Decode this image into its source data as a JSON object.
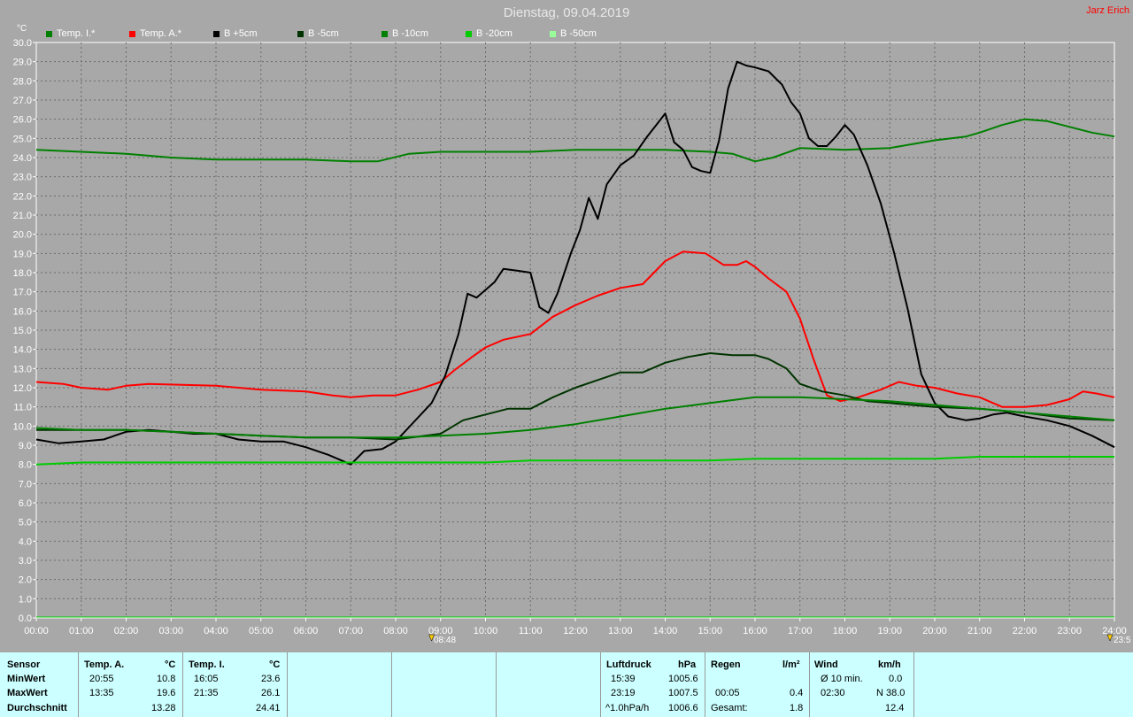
{
  "title": "Dienstag, 09.04.2019",
  "author": "Jarz Erich",
  "chart_data": {
    "type": "line",
    "ylabel": "°C",
    "ylim": [
      0,
      30
    ],
    "y_ticks": [
      "0.0",
      "1.0",
      "2.0",
      "3.0",
      "4.0",
      "5.0",
      "6.0",
      "7.0",
      "8.0",
      "9.0",
      "10.0",
      "11.0",
      "12.0",
      "13.0",
      "14.0",
      "15.0",
      "16.0",
      "17.0",
      "18.0",
      "19.0",
      "20.0",
      "21.0",
      "22.0",
      "23.0",
      "24.0",
      "25.0",
      "26.0",
      "27.0",
      "28.0",
      "29.0",
      "30.0"
    ],
    "xlim": [
      0,
      24
    ],
    "x_ticks": [
      "00:00",
      "01:00",
      "02:00",
      "03:00",
      "04:00",
      "05:00",
      "06:00",
      "07:00",
      "08:00",
      "09:00",
      "10:00",
      "11:00",
      "12:00",
      "13:00",
      "14:00",
      "15:00",
      "16:00",
      "17:00",
      "18:00",
      "19:00",
      "20:00",
      "21:00",
      "22:00",
      "23:00",
      "24:00"
    ],
    "grid": true,
    "legend_position": "top",
    "markers": [
      {
        "label": "08:48",
        "x": 8.8
      },
      {
        "label": "23:5",
        "x": 23.9
      }
    ],
    "series": [
      {
        "name": "Temp. I.*",
        "color": "#008000",
        "width": 2,
        "points": [
          [
            0,
            24.4
          ],
          [
            1,
            24.3
          ],
          [
            2,
            24.2
          ],
          [
            3,
            24.0
          ],
          [
            4,
            23.9
          ],
          [
            5,
            23.9
          ],
          [
            6,
            23.9
          ],
          [
            7,
            23.8
          ],
          [
            7.6,
            23.8
          ],
          [
            8.3,
            24.2
          ],
          [
            9,
            24.3
          ],
          [
            10,
            24.3
          ],
          [
            11,
            24.3
          ],
          [
            12,
            24.4
          ],
          [
            13,
            24.4
          ],
          [
            14,
            24.4
          ],
          [
            15,
            24.3
          ],
          [
            15.5,
            24.2
          ],
          [
            16,
            23.8
          ],
          [
            16.4,
            24.0
          ],
          [
            17,
            24.5
          ],
          [
            18,
            24.4
          ],
          [
            19,
            24.5
          ],
          [
            20,
            24.9
          ],
          [
            20.7,
            25.1
          ],
          [
            21,
            25.3
          ],
          [
            21.5,
            25.7
          ],
          [
            22,
            26.0
          ],
          [
            22.5,
            25.9
          ],
          [
            23,
            25.6
          ],
          [
            23.5,
            25.3
          ],
          [
            24,
            25.1
          ]
        ]
      },
      {
        "name": "Temp. A.*",
        "color": "#ff0000",
        "width": 2,
        "points": [
          [
            0,
            12.3
          ],
          [
            0.6,
            12.2
          ],
          [
            1,
            12.0
          ],
          [
            1.6,
            11.9
          ],
          [
            2,
            12.1
          ],
          [
            2.5,
            12.2
          ],
          [
            4,
            12.1
          ],
          [
            5,
            11.9
          ],
          [
            6,
            11.8
          ],
          [
            6.6,
            11.6
          ],
          [
            7,
            11.5
          ],
          [
            7.5,
            11.6
          ],
          [
            8,
            11.6
          ],
          [
            8.5,
            11.9
          ],
          [
            9,
            12.3
          ],
          [
            9.3,
            12.9
          ],
          [
            9.7,
            13.6
          ],
          [
            10,
            14.1
          ],
          [
            10.4,
            14.5
          ],
          [
            11,
            14.8
          ],
          [
            11.5,
            15.7
          ],
          [
            12,
            16.3
          ],
          [
            12.5,
            16.8
          ],
          [
            13,
            17.2
          ],
          [
            13.5,
            17.4
          ],
          [
            14,
            18.6
          ],
          [
            14.4,
            19.1
          ],
          [
            14.9,
            19.0
          ],
          [
            15.3,
            18.4
          ],
          [
            15.6,
            18.4
          ],
          [
            15.8,
            18.6
          ],
          [
            16,
            18.3
          ],
          [
            16.3,
            17.7
          ],
          [
            16.7,
            17.0
          ],
          [
            17,
            15.6
          ],
          [
            17.3,
            13.5
          ],
          [
            17.6,
            11.6
          ],
          [
            17.9,
            11.3
          ],
          [
            18.3,
            11.5
          ],
          [
            18.8,
            11.9
          ],
          [
            19.2,
            12.3
          ],
          [
            19.6,
            12.1
          ],
          [
            20,
            12.0
          ],
          [
            20.5,
            11.7
          ],
          [
            21,
            11.5
          ],
          [
            21.5,
            11.0
          ],
          [
            22,
            11.0
          ],
          [
            22.5,
            11.1
          ],
          [
            23,
            11.4
          ],
          [
            23.3,
            11.8
          ],
          [
            23.6,
            11.7
          ],
          [
            24,
            11.5
          ]
        ]
      },
      {
        "name": "B +5cm",
        "color": "#000000",
        "width": 2,
        "points": [
          [
            0,
            9.3
          ],
          [
            0.5,
            9.1
          ],
          [
            1,
            9.2
          ],
          [
            1.5,
            9.3
          ],
          [
            2,
            9.7
          ],
          [
            2.5,
            9.8
          ],
          [
            3,
            9.7
          ],
          [
            3.5,
            9.6
          ],
          [
            4,
            9.6
          ],
          [
            4.5,
            9.3
          ],
          [
            5,
            9.2
          ],
          [
            5.5,
            9.2
          ],
          [
            6,
            8.9
          ],
          [
            6.5,
            8.5
          ],
          [
            7,
            8.0
          ],
          [
            7.3,
            8.7
          ],
          [
            7.7,
            8.8
          ],
          [
            8,
            9.2
          ],
          [
            8.4,
            10.2
          ],
          [
            8.8,
            11.2
          ],
          [
            9.1,
            12.6
          ],
          [
            9.4,
            14.8
          ],
          [
            9.6,
            16.9
          ],
          [
            9.8,
            16.7
          ],
          [
            10,
            17.1
          ],
          [
            10.2,
            17.5
          ],
          [
            10.4,
            18.2
          ],
          [
            10.7,
            18.1
          ],
          [
            11,
            18.0
          ],
          [
            11.2,
            16.2
          ],
          [
            11.4,
            15.9
          ],
          [
            11.6,
            16.9
          ],
          [
            11.9,
            19.0
          ],
          [
            12.1,
            20.2
          ],
          [
            12.3,
            21.9
          ],
          [
            12.5,
            20.8
          ],
          [
            12.7,
            22.6
          ],
          [
            13,
            23.6
          ],
          [
            13.3,
            24.1
          ],
          [
            13.6,
            25.1
          ],
          [
            13.8,
            25.7
          ],
          [
            14,
            26.3
          ],
          [
            14.2,
            24.8
          ],
          [
            14.4,
            24.4
          ],
          [
            14.6,
            23.5
          ],
          [
            14.8,
            23.3
          ],
          [
            15,
            23.2
          ],
          [
            15.2,
            24.9
          ],
          [
            15.4,
            27.6
          ],
          [
            15.6,
            29.0
          ],
          [
            15.8,
            28.8
          ],
          [
            16,
            28.7
          ],
          [
            16.3,
            28.5
          ],
          [
            16.6,
            27.8
          ],
          [
            16.8,
            26.9
          ],
          [
            17,
            26.3
          ],
          [
            17.2,
            25.0
          ],
          [
            17.4,
            24.6
          ],
          [
            17.6,
            24.6
          ],
          [
            17.8,
            25.1
          ],
          [
            18,
            25.7
          ],
          [
            18.2,
            25.2
          ],
          [
            18.5,
            23.6
          ],
          [
            18.8,
            21.6
          ],
          [
            19.1,
            19.0
          ],
          [
            19.4,
            16.1
          ],
          [
            19.7,
            12.7
          ],
          [
            20,
            11.2
          ],
          [
            20.3,
            10.5
          ],
          [
            20.7,
            10.3
          ],
          [
            21,
            10.4
          ],
          [
            21.3,
            10.6
          ],
          [
            21.6,
            10.7
          ],
          [
            22,
            10.5
          ],
          [
            22.5,
            10.3
          ],
          [
            23,
            10.0
          ],
          [
            23.5,
            9.5
          ],
          [
            24,
            8.9
          ]
        ]
      },
      {
        "name": "B -5cm",
        "color": "#003300",
        "width": 2,
        "points": [
          [
            0,
            9.8
          ],
          [
            1,
            9.8
          ],
          [
            2,
            9.8
          ],
          [
            3,
            9.7
          ],
          [
            4,
            9.6
          ],
          [
            5,
            9.5
          ],
          [
            6,
            9.4
          ],
          [
            7,
            9.4
          ],
          [
            8,
            9.3
          ],
          [
            9,
            9.6
          ],
          [
            9.5,
            10.3
          ],
          [
            10,
            10.6
          ],
          [
            10.5,
            10.9
          ],
          [
            11,
            10.9
          ],
          [
            11.5,
            11.5
          ],
          [
            12,
            12.0
          ],
          [
            12.5,
            12.4
          ],
          [
            13,
            12.8
          ],
          [
            13.5,
            12.8
          ],
          [
            14,
            13.3
          ],
          [
            14.5,
            13.6
          ],
          [
            15,
            13.8
          ],
          [
            15.5,
            13.7
          ],
          [
            16,
            13.7
          ],
          [
            16.3,
            13.5
          ],
          [
            16.7,
            13.0
          ],
          [
            17,
            12.2
          ],
          [
            17.5,
            11.8
          ],
          [
            18,
            11.6
          ],
          [
            18.5,
            11.3
          ],
          [
            19,
            11.2
          ],
          [
            20,
            11.0
          ],
          [
            21,
            10.9
          ],
          [
            22,
            10.7
          ],
          [
            23,
            10.4
          ],
          [
            24,
            10.3
          ]
        ]
      },
      {
        "name": "B -10cm",
        "color": "#008000",
        "width": 2,
        "points": [
          [
            0,
            9.9
          ],
          [
            1,
            9.8
          ],
          [
            2,
            9.8
          ],
          [
            3,
            9.7
          ],
          [
            4,
            9.6
          ],
          [
            5,
            9.5
          ],
          [
            6,
            9.4
          ],
          [
            7,
            9.4
          ],
          [
            8,
            9.4
          ],
          [
            9,
            9.5
          ],
          [
            10,
            9.6
          ],
          [
            11,
            9.8
          ],
          [
            12,
            10.1
          ],
          [
            13,
            10.5
          ],
          [
            14,
            10.9
          ],
          [
            15,
            11.2
          ],
          [
            16,
            11.5
          ],
          [
            17,
            11.5
          ],
          [
            18,
            11.4
          ],
          [
            19,
            11.3
          ],
          [
            20,
            11.1
          ],
          [
            21,
            10.9
          ],
          [
            22,
            10.7
          ],
          [
            23,
            10.5
          ],
          [
            24,
            10.3
          ]
        ]
      },
      {
        "name": "B -20cm",
        "color": "#00cc00",
        "width": 2,
        "points": [
          [
            0,
            8.0
          ],
          [
            1,
            8.1
          ],
          [
            2,
            8.1
          ],
          [
            3,
            8.1
          ],
          [
            4,
            8.1
          ],
          [
            5,
            8.1
          ],
          [
            6,
            8.1
          ],
          [
            7,
            8.1
          ],
          [
            8,
            8.1
          ],
          [
            9,
            8.1
          ],
          [
            10,
            8.1
          ],
          [
            11,
            8.2
          ],
          [
            12,
            8.2
          ],
          [
            13,
            8.2
          ],
          [
            14,
            8.2
          ],
          [
            15,
            8.2
          ],
          [
            16,
            8.3
          ],
          [
            17,
            8.3
          ],
          [
            18,
            8.3
          ],
          [
            19,
            8.3
          ],
          [
            20,
            8.3
          ],
          [
            21,
            8.4
          ],
          [
            22,
            8.4
          ],
          [
            23,
            8.4
          ],
          [
            24,
            8.4
          ]
        ]
      },
      {
        "name": "B -50cm",
        "color": "#99ff99",
        "width": 2,
        "points": []
      }
    ]
  },
  "footer": {
    "sensor_col": {
      "header": "Sensor",
      "rows": [
        "MinWert",
        "MaxWert",
        "Durchschnitt"
      ]
    },
    "temp_a": {
      "header": "Temp. A.",
      "unit": "°C",
      "min_time": "20:55",
      "min_val": "10.8",
      "max_time": "13:35",
      "max_val": "19.6",
      "avg_val": "13.28"
    },
    "temp_i": {
      "header": "Temp. I.",
      "unit": "°C",
      "min_time": "16:05",
      "min_val": "23.6",
      "max_time": "21:35",
      "max_val": "26.1",
      "avg_val": "24.41"
    },
    "pressure": {
      "header": "Luftdruck",
      "unit": "hPa",
      "min_time": "15:39",
      "min_val": "1005.6",
      "max_time": "23:19",
      "max_val": "1007.5",
      "trend_label": "^1.0hPa/h",
      "trend_val": "1006.6"
    },
    "rain": {
      "header": "Regen",
      "unit": "l/m²",
      "max_time": "00:05",
      "max_val": "0.4",
      "total_label": "Gesamt:",
      "total_val": "1.8"
    },
    "wind": {
      "header": "Wind",
      "unit": "km/h",
      "avg_label": "Ø 10 min.",
      "avg_val": "0.0",
      "max_time": "02:30",
      "max_val": "N 38.0",
      "mean_val": "12.4"
    }
  }
}
